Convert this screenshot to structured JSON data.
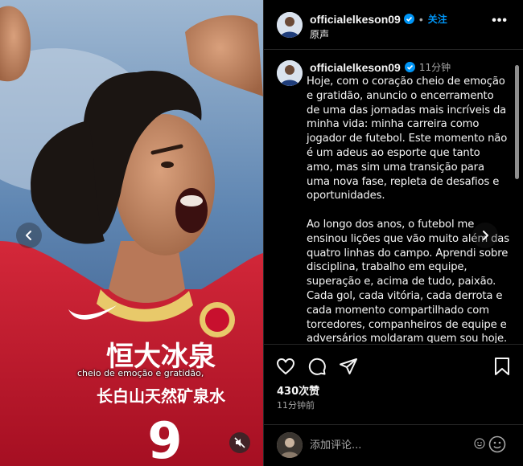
{
  "post": {
    "username": "officialelkeson09",
    "follow_label": "关注",
    "audio_label": "原声",
    "time_ago": "11分钟",
    "caption_paragraphs": [
      "Hoje, com o coração cheio de emoção e gratidão, anuncio o encerramento de uma das jornadas mais incríveis da minha vida: minha carreira como jogador de futebol. Este momento não é um adeus ao esporte que tanto amo, mas sim uma transição para uma nova fase, repleta de desafios e oportunidades.",
      "Ao longo dos anos, o futebol me ensinou lições que vão muito além das quatro linhas do campo. Aprendi sobre disciplina, trabalho em equipe, superação e, acima de tudo, paixão. Cada gol, cada vitória, cada derrota e cada momento compartilhado com torcedores, companheiros de equipe e adversários moldaram quem sou hoje."
    ],
    "likes": "430次赞",
    "posted": "11分钟前",
    "comment_placeholder": "添加评论..."
  },
  "media": {
    "subtitle": "cheio de emoção e gratidão,",
    "jersey_text_line1": "恒大冰泉",
    "jersey_text_line2": "长白山天然矿泉水",
    "jersey_number": "9"
  },
  "icons": {
    "prev": "chevron-left-icon",
    "next": "chevron-right-icon",
    "mute": "muted-speaker-icon",
    "verified": "verified-badge-icon",
    "like": "heart-icon",
    "comment": "comment-bubble-icon",
    "share": "paper-plane-icon",
    "save": "bookmark-icon",
    "emoji": "smiley-icon",
    "more": "ellipsis-icon"
  },
  "colors": {
    "background": "#000000",
    "accent": "#0095f6",
    "verified": "#0095f6",
    "jersey_red": "#c8102e",
    "muted_text": "#a8a8a8"
  }
}
